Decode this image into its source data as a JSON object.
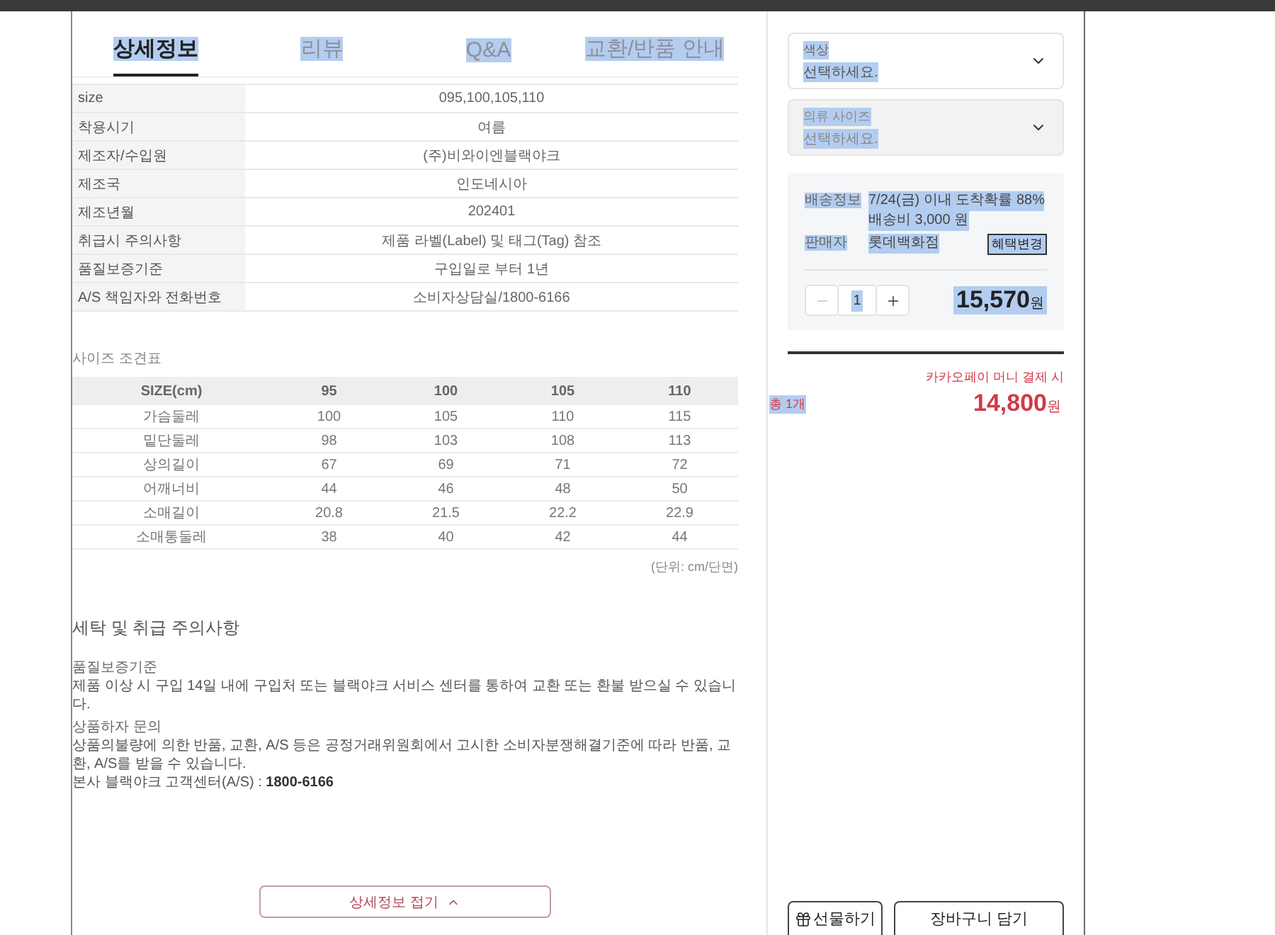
{
  "tabs": [
    {
      "label": "상세정보",
      "selected": true,
      "highlighted": true
    },
    {
      "label": "리뷰",
      "selected": false,
      "highlighted": true
    },
    {
      "label": "Q&A",
      "selected": false,
      "highlighted": true
    },
    {
      "label": "교환/반품 안내",
      "selected": false,
      "highlighted": true
    }
  ],
  "spec_table": {
    "rows": [
      {
        "label": "size",
        "value": "095,100,105,110"
      },
      {
        "label": "착용시기",
        "value": "여름"
      },
      {
        "label": "제조자/수입원",
        "value": "(주)비와이엔블랙야크"
      },
      {
        "label": "제조국",
        "value": "인도네시아"
      },
      {
        "label": "제조년월",
        "value": "202401"
      },
      {
        "label": "취급시 주의사항",
        "value": "제품 라벨(Label) 및 태그(Tag) 참조"
      },
      {
        "label": "품질보증기준",
        "value": "구입일로 부터 1년"
      },
      {
        "label": "A/S 책임자와 전화번호",
        "value": "소비자상담실/1800-6166"
      }
    ]
  },
  "size_chart": {
    "title": "사이즈 조견표",
    "columns": [
      "SIZE(cm)",
      "95",
      "100",
      "105",
      "110"
    ],
    "rows": [
      {
        "label": "가슴둘레",
        "values": [
          "100",
          "105",
          "110",
          "115"
        ]
      },
      {
        "label": "밑단둘레",
        "values": [
          "98",
          "103",
          "108",
          "113"
        ]
      },
      {
        "label": "상의길이",
        "values": [
          "67",
          "69",
          "71",
          "72"
        ]
      },
      {
        "label": "어깨너비",
        "values": [
          "44",
          "46",
          "48",
          "50"
        ]
      },
      {
        "label": "소매길이",
        "values": [
          "20.8",
          "21.5",
          "22.2",
          "22.9"
        ]
      },
      {
        "label": "소매통둘레",
        "values": [
          "38",
          "40",
          "42",
          "44"
        ]
      }
    ],
    "unit_note": "(단위: cm/단면)"
  },
  "care": {
    "title": "세탁 및 취급 주의사항",
    "sections": [
      {
        "heading": "품질보증기준",
        "lines": [
          "제품 이상 시 구입 14일 내에 구입처 또는 블랙야크 서비스 센터를 통하여 교환 또는 환불 받으실 수 있습니다."
        ]
      },
      {
        "heading": "상품하자 문의",
        "lines": [
          "상품의불량에 의한 반품, 교환, A/S 등은 공정거래위원회에서 고시한 소비자분쟁해결기준에 따라 반품, 교환, A/S를 받을 수 있습니다.",
          "본사 블랙야크 고객센터(A/S) : **1800-6166**"
        ]
      }
    ]
  },
  "collapse_button": {
    "label": "상세정보 접기"
  },
  "options": [
    {
      "label": "색상",
      "placeholder": "선택하세요.",
      "disabled": false,
      "highlighted": true
    },
    {
      "label": "의류 사이즈",
      "placeholder": "선택하세요.",
      "disabled": true,
      "highlighted": true
    }
  ],
  "delivery": {
    "highlighted": true,
    "rows": [
      {
        "label": "배송정보",
        "lines": [
          "7/24(금) 이내 도착확률 88%",
          "배송비 3,000 원"
        ]
      },
      {
        "label": "판매자",
        "lines": [
          "롯데백화점"
        ],
        "action": "혜택변경"
      }
    ]
  },
  "quantity": {
    "value": "1",
    "decrease_disabled": true,
    "highlighted": true
  },
  "price": {
    "amount": "15,570",
    "unit": "원",
    "highlighted": true
  },
  "payment_note": "카카오페이 머니 결제 시",
  "total": {
    "count": "총 1개",
    "count_highlighted": true,
    "amount": "14,800",
    "unit": "원"
  },
  "buttons": [
    {
      "label": "선물하기",
      "kind": "gift"
    },
    {
      "label": "장바구니 담기",
      "kind": "cart"
    }
  ]
}
